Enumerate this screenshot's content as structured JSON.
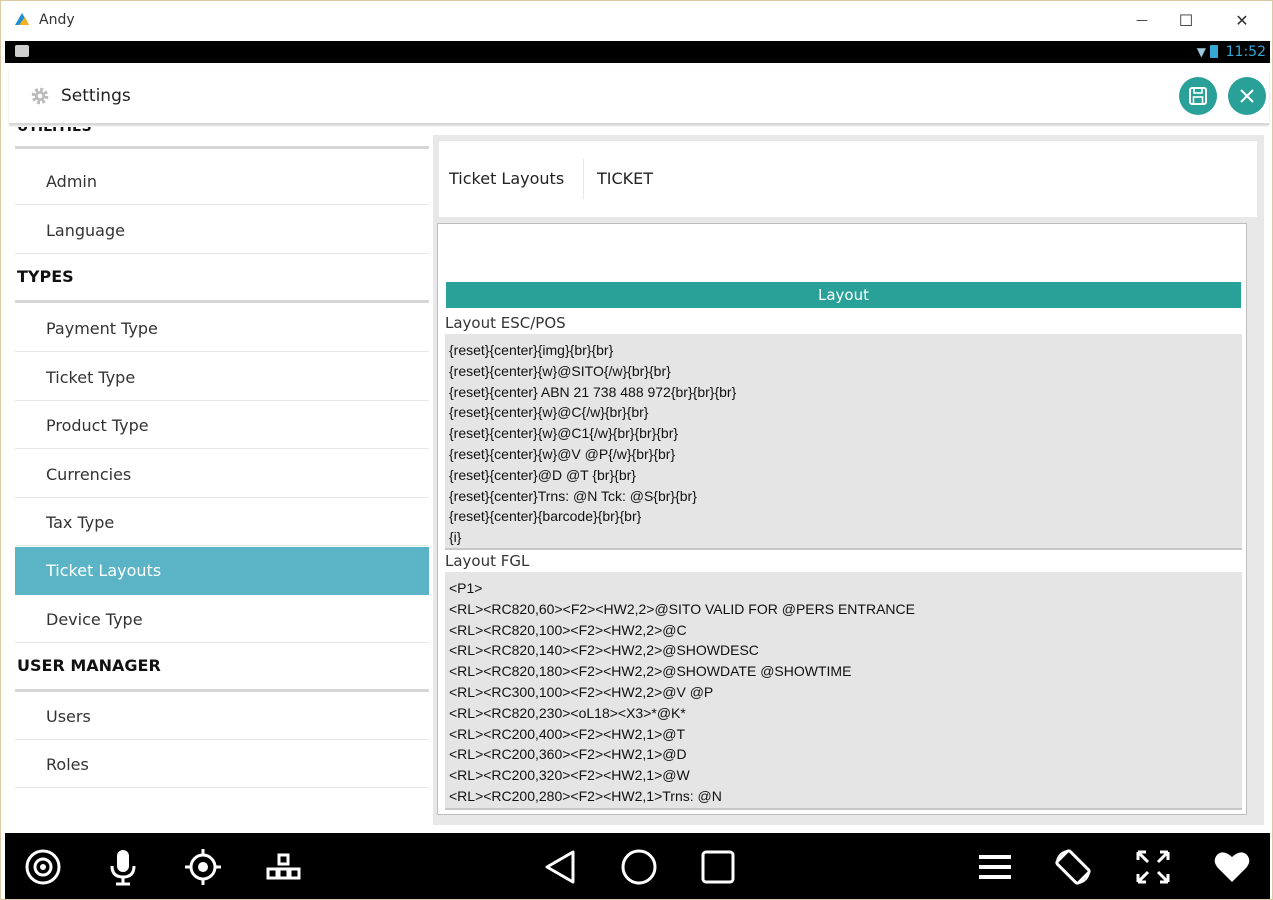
{
  "window": {
    "title": "Andy",
    "minimize": "—",
    "maximize": "☐",
    "close": "✕"
  },
  "statusbar": {
    "time": "11:52"
  },
  "header": {
    "title": "Settings",
    "icon": "gear-icon",
    "save_icon": "save-icon",
    "close_icon": "close-icon"
  },
  "sidebar": {
    "top_partial": "UTILITIES",
    "sections": [
      {
        "title": "TYPES"
      },
      {
        "title": "USER MANAGER"
      }
    ],
    "items": [
      {
        "label": "Admin"
      },
      {
        "label": "Language"
      },
      {
        "label": "Payment Type"
      },
      {
        "label": "Ticket Type"
      },
      {
        "label": "Product Type"
      },
      {
        "label": "Currencies"
      },
      {
        "label": "Tax Type"
      },
      {
        "label": "Ticket Layouts"
      },
      {
        "label": "Device Type"
      },
      {
        "label": "Users"
      },
      {
        "label": "Roles"
      }
    ],
    "active_item": "Ticket Layouts"
  },
  "tabs": [
    {
      "label": "Ticket Layouts"
    },
    {
      "label": "TICKET"
    }
  ],
  "form": {
    "section_bar": "Layout",
    "esc_label": "Layout ESC/POS",
    "esc_lines": [
      "{reset}{center}{img}{br}{br}",
      "{reset}{center}{w}@SITO{/w}{br}{br}",
      "{reset}{center} ABN 21 738 488 972{br}{br}{br}",
      "{reset}{center}{w}@C{/w}{br}{br}",
      "{reset}{center}{w}@C1{/w}{br}{br}{br}",
      "{reset}{center}{w}@V @P{/w}{br}{br}",
      "{reset}{center}@D @T {br}{br}",
      "{reset}{center}Trns: @N Tck: @S{br}{br}",
      "{reset}{center}{barcode}{br}{br}",
      "{i}"
    ],
    "fgl_label": "Layout FGL",
    "fgl_lines": [
      "<P1>",
      "<RL><RC820,60><F2><HW2,2>@SITO VALID FOR @PERS ENTRANCE",
      "<RL><RC820,100><F2><HW2,2>@C",
      "<RL><RC820,140><F2><HW2,2>@SHOWDESC",
      "<RL><RC820,180><F2><HW2,2>@SHOWDATE @SHOWTIME",
      "<RL><RC300,100><F2><HW2,2>@V @P",
      "<RL><RC820,230><oL18><X3>*@K*",
      "<RL><RC200,400><F2><HW2,1>@T",
      "<RL><RC200,360><F2><HW2,1>@D",
      "<RL><RC200,320><F2><HW2,1>@W",
      "<RL><RC200,280><F2><HW2,1>Trns: @N"
    ]
  },
  "navbar": {
    "icons": [
      "camera-icon",
      "microphone-icon",
      "location-icon",
      "apps-icon",
      "back-icon",
      "home-icon",
      "recents-icon",
      "menu-icon",
      "rotate-icon",
      "fullscreen-icon",
      "heart-icon"
    ]
  },
  "colors": {
    "accent": "#2aa198",
    "active_item": "#5ab4c5",
    "status_time": "#35a8d8"
  }
}
